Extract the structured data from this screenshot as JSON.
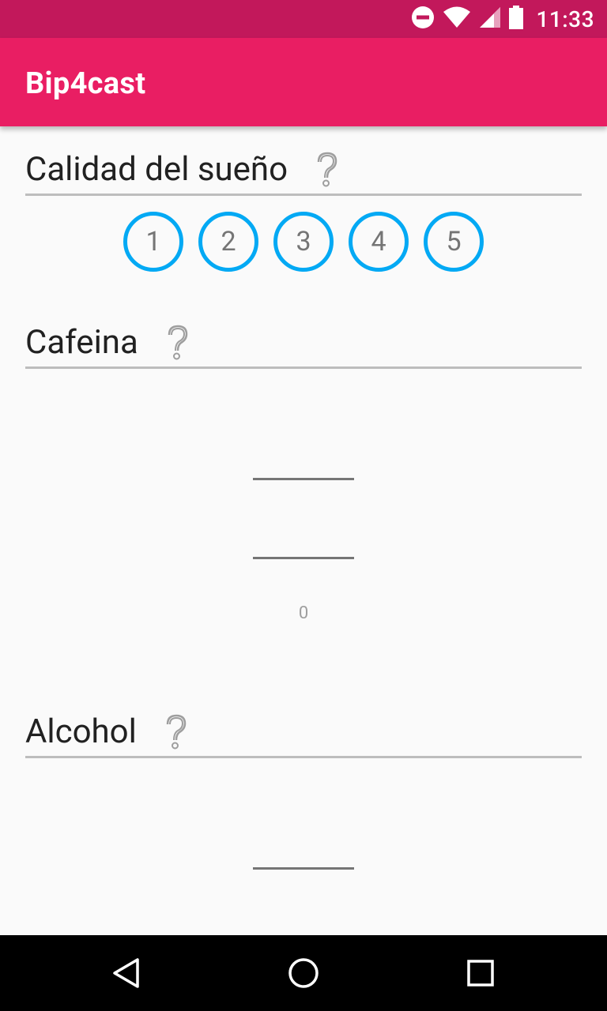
{
  "status_bar": {
    "time": "11:33",
    "icons": [
      "do-not-disturb-icon",
      "wifi-icon",
      "cell-signal-icon",
      "battery-icon"
    ],
    "background": "#c2185b"
  },
  "app_bar": {
    "title": "Bip4cast",
    "background": "#e91e63"
  },
  "sleep_quality": {
    "title": "Calidad del sueño",
    "help_icon": "help-icon",
    "options": [
      "1",
      "2",
      "3",
      "4",
      "5"
    ],
    "accent": "#03a9f4"
  },
  "caffeine": {
    "title": "Cafeina",
    "help_icon": "help-icon",
    "value": "0"
  },
  "alcohol": {
    "title": "Alcohol",
    "help_icon": "help-icon"
  },
  "nav_bar": {
    "icons": [
      "back-icon",
      "home-icon",
      "recents-icon"
    ]
  }
}
